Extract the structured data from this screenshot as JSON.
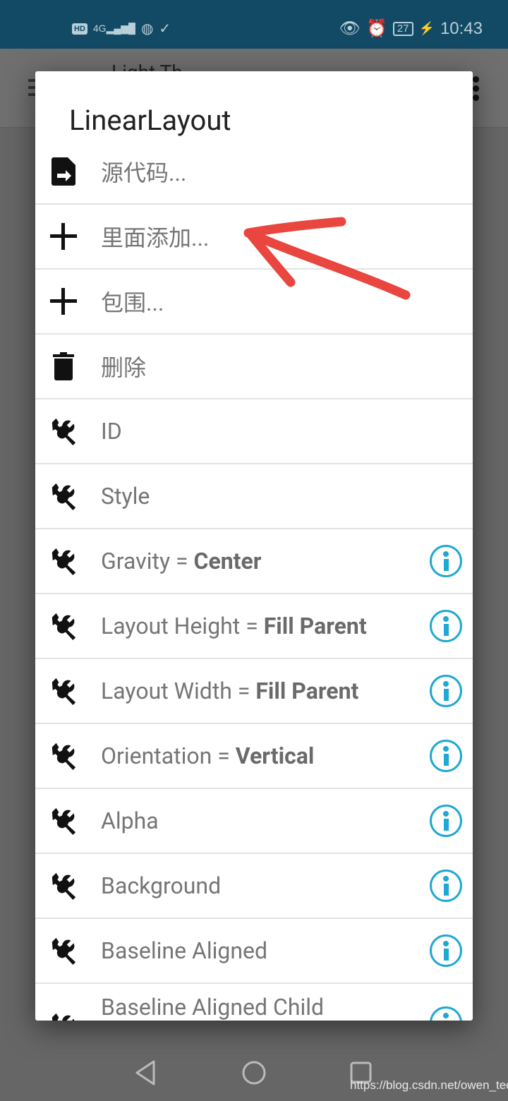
{
  "status_bar": {
    "network": "4G",
    "time": "10:43",
    "battery": "27"
  },
  "app_bar": {
    "title": "Light Th"
  },
  "dialog": {
    "title": "LinearLayout",
    "items": [
      {
        "icon": "file-export-icon",
        "label": "源代码...",
        "value": "",
        "info": false
      },
      {
        "icon": "plus-icon",
        "label": "里面添加...",
        "value": "",
        "info": false
      },
      {
        "icon": "plus-icon",
        "label": "包围...",
        "value": "",
        "info": false
      },
      {
        "icon": "trash-icon",
        "label": "删除",
        "value": "",
        "info": false
      },
      {
        "icon": "wrench-icon",
        "label": "ID",
        "value": "",
        "info": false
      },
      {
        "icon": "wrench-icon",
        "label": "Style",
        "value": "",
        "info": false
      },
      {
        "icon": "wrench-icon",
        "label": "Gravity = ",
        "value": "Center",
        "info": true
      },
      {
        "icon": "wrench-icon",
        "label": "Layout Height = ",
        "value": "Fill Parent",
        "info": true
      },
      {
        "icon": "wrench-icon",
        "label": "Layout Width = ",
        "value": "Fill Parent",
        "info": true
      },
      {
        "icon": "wrench-icon",
        "label": "Orientation = ",
        "value": "Vertical",
        "info": true
      },
      {
        "icon": "wrench-icon",
        "label": "Alpha",
        "value": "",
        "info": true
      },
      {
        "icon": "wrench-icon",
        "label": "Background",
        "value": "",
        "info": true
      },
      {
        "icon": "wrench-icon",
        "label": "Baseline Aligned",
        "value": "",
        "info": true
      },
      {
        "icon": "wrench-icon",
        "label": "Baseline Aligned Child",
        "value": "",
        "info": true
      }
    ]
  },
  "watermark": "https://blog.csdn.net/owen_ted",
  "colors": {
    "status_bar": "#124a65",
    "info_accent": "#1ea8d4",
    "annotation_arrow": "#e8463e"
  }
}
